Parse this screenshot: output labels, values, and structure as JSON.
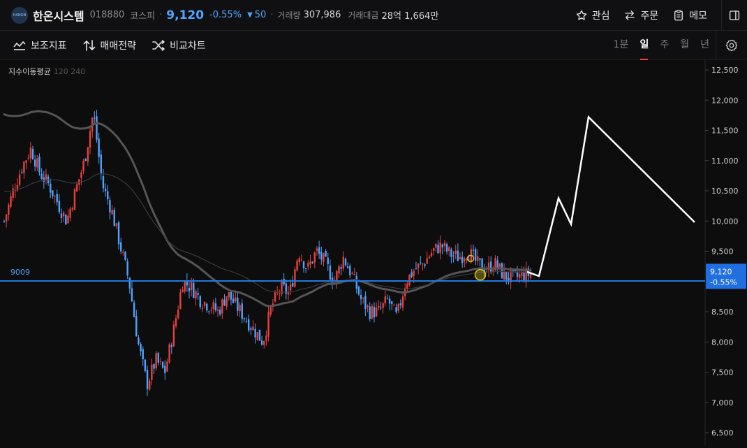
{
  "stock": {
    "logo_text": "HANON",
    "name": "한온시스템",
    "code": "018880",
    "market": "코스피",
    "price": "9,120",
    "change_pct": "-0.55%",
    "change_abs": "50",
    "volume_label": "거래량",
    "volume": "307,986",
    "amount_label": "거래대금",
    "amount": "28억 1,664만",
    "color_down": "#4ea3ff",
    "color_up": "#e8413c"
  },
  "top_actions": {
    "watch": "관심",
    "order": "주문",
    "memo": "메모"
  },
  "toolbar": {
    "indicators": "보조지표",
    "strategy": "매매전략",
    "compare": "비교차트",
    "periods": [
      "1분",
      "일",
      "주",
      "월",
      "년"
    ],
    "active_period": "일"
  },
  "legend": {
    "ma_label": "지수이동평균",
    "ma_periods": "120 240"
  },
  "chart_data": {
    "type": "candlestick",
    "y_ticks": [
      "12,500",
      "12,000",
      "11,500",
      "11,000",
      "10,500",
      "10,000",
      "9,500",
      "9,009",
      "8,500",
      "8,000",
      "7,500",
      "7,000",
      "6,500"
    ],
    "y_range": [
      6500,
      12500
    ],
    "horizontal_line": {
      "value": 9009,
      "label": "9009",
      "color": "#1f7ae0"
    },
    "current_price_tag": {
      "price": "9,120",
      "change": "-0.55%",
      "value": 9120
    },
    "ma120_color": "#555558",
    "ma240_color": "#3a3a3c",
    "drawn_path_color": "#ffffff",
    "drawn_path": [
      [
        9090,
        0
      ],
      [
        10380,
        0
      ],
      [
        9950,
        0
      ],
      [
        11720,
        0
      ],
      [
        9980,
        0
      ]
    ],
    "markers": [
      {
        "type": "circle",
        "price": 9380,
        "color": "#d9c21a"
      },
      {
        "type": "circle",
        "price": 9110,
        "color": "#d9c21a"
      }
    ],
    "anchors": [
      10000,
      10500,
      10900,
      11200,
      10800,
      10600,
      10300,
      10000,
      10500,
      11000,
      11800,
      10600,
      10200,
      9600,
      9000,
      8000,
      7300,
      7700,
      7500,
      8200,
      9000,
      8900,
      8700,
      8600,
      8500,
      8800,
      8600,
      8400,
      8200,
      8000,
      8600,
      8900,
      8800,
      9500,
      9200,
      9500,
      9300,
      9000,
      9400,
      9100,
      8700,
      8500,
      8500,
      8700,
      8400,
      9000,
      9200,
      9300,
      9500,
      9600,
      9450,
      9400,
      9500,
      9300,
      9200,
      9300,
      9100,
      9050,
      9100,
      9120
    ]
  }
}
